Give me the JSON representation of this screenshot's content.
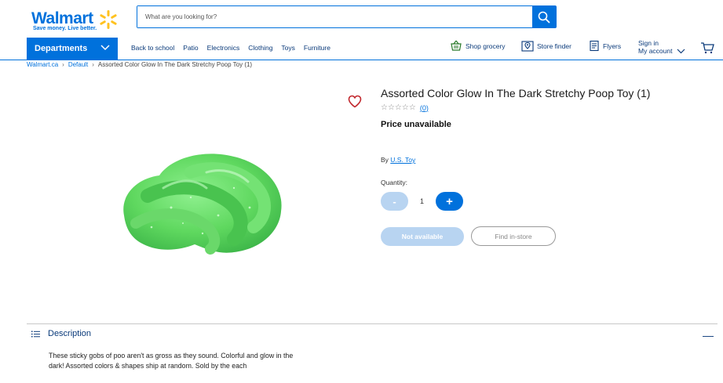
{
  "header": {
    "brand": "Walmart",
    "tagline": "Save money. Live better.",
    "search_placeholder": "What are you looking for?"
  },
  "nav": {
    "departments_label": "Departments",
    "links": [
      "Back to school",
      "Patio",
      "Electronics",
      "Clothing",
      "Toys",
      "Furniture"
    ],
    "shop_grocery": "Shop grocery",
    "store_finder": "Store finder",
    "flyers": "Flyers",
    "sign_in": "Sign in",
    "my_account": "My account"
  },
  "breadcrumb": {
    "items": [
      "Walmart.ca",
      "Default"
    ],
    "current": "Assorted Color Glow In The Dark Stretchy Poop Toy (1)"
  },
  "product": {
    "title": "Assorted Color Glow In The Dark Stretchy Poop Toy (1)",
    "stars": "☆☆☆☆☆",
    "review_count": "(0)",
    "price": "Price unavailable",
    "by_prefix": "By",
    "brand": "U.S. Toy",
    "quantity_label": "Quantity:",
    "quantity": "1",
    "minus": "-",
    "plus": "+",
    "not_available_label": "Not available",
    "find_in_store_label": "Find in-store"
  },
  "description": {
    "heading": "Description",
    "collapse_symbol": "—",
    "text": "These sticky gobs of poo aren't as gross as they sound. Colorful and glow in the dark! Assorted colors & shapes ship at random. Sold by the each"
  },
  "colors": {
    "brand_blue": "#0071dc",
    "spark_yellow": "#ffc220",
    "slime_green": "#6fe06f",
    "heart_red": "#c1272d",
    "disabled_blue": "#b8d4f1"
  }
}
